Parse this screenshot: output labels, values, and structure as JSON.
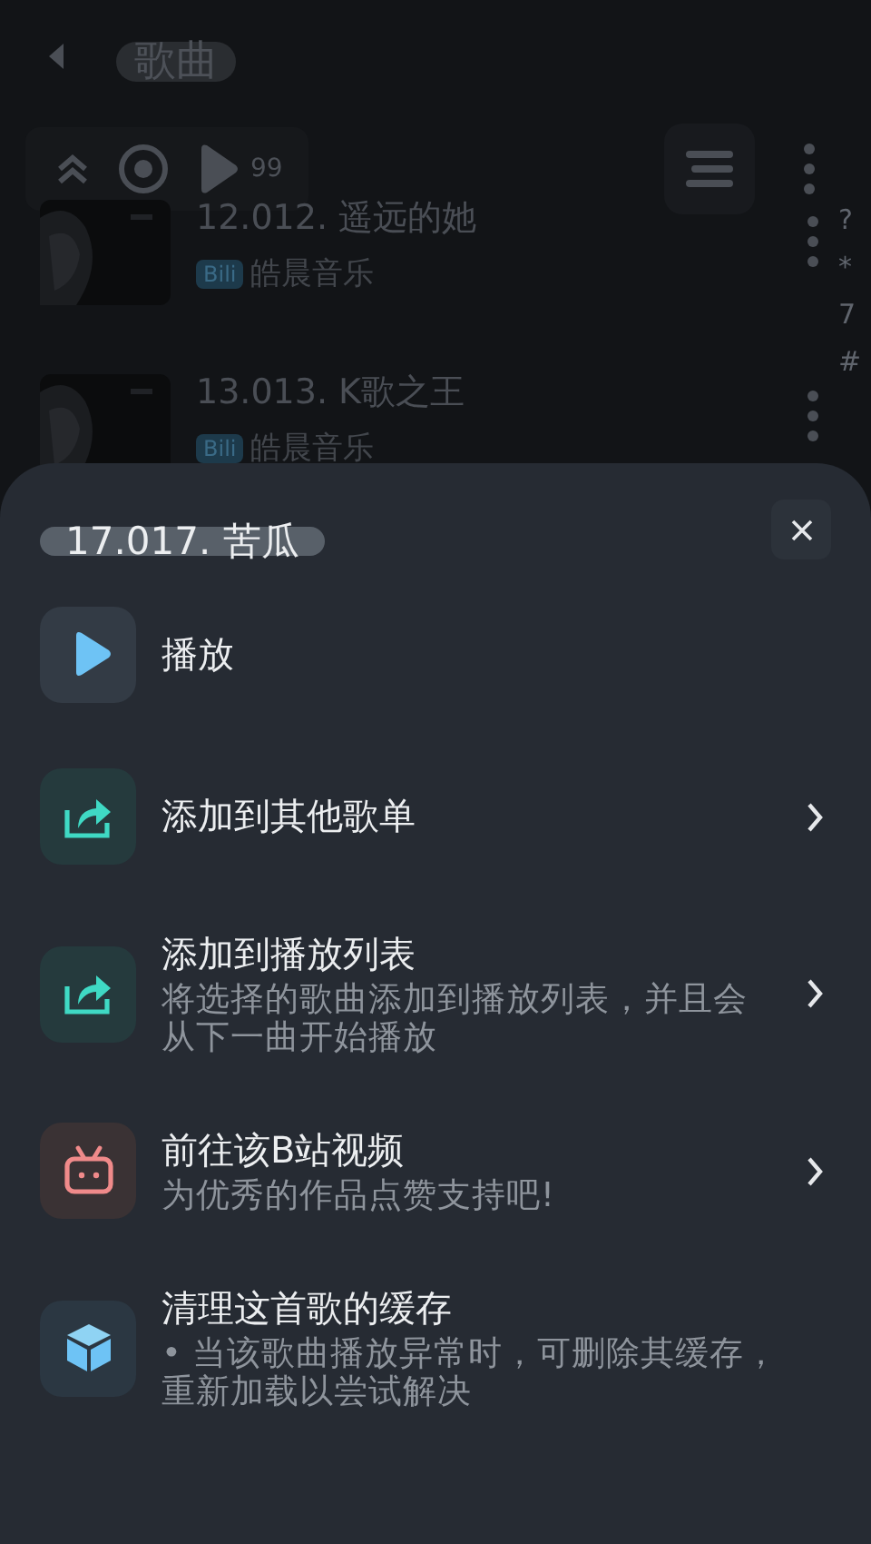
{
  "header": {
    "title": "歌曲"
  },
  "toolbar": {
    "count": "99"
  },
  "songs": [
    {
      "title": "12.012. 遥远的她",
      "source": "Bili",
      "artist": "皓晨音乐"
    },
    {
      "title": "13.013. K歌之王",
      "source": "Bili",
      "artist": "皓晨音乐"
    }
  ],
  "index_letters": [
    "?",
    "*",
    "7",
    "#"
  ],
  "sheet": {
    "title": "17.017. 苦瓜",
    "items": [
      {
        "kind": "play",
        "title": "播放",
        "chevron": false
      },
      {
        "kind": "share",
        "title": "添加到其他歌单",
        "chevron": true
      },
      {
        "kind": "share",
        "title": "添加到播放列表",
        "subtitle": "将选择的歌曲添加到播放列表，并且会从下一曲开始播放",
        "chevron": true
      },
      {
        "kind": "bili",
        "title": "前往该B站视频",
        "subtitle": "为优秀的作品点赞支持吧!",
        "chevron": true
      },
      {
        "kind": "cube",
        "title": "清理这首歌的缓存",
        "subtitle": "• 当该歌曲播放异常时，可删除其缓存，重新加载以尝试解决",
        "chevron": false
      }
    ]
  }
}
